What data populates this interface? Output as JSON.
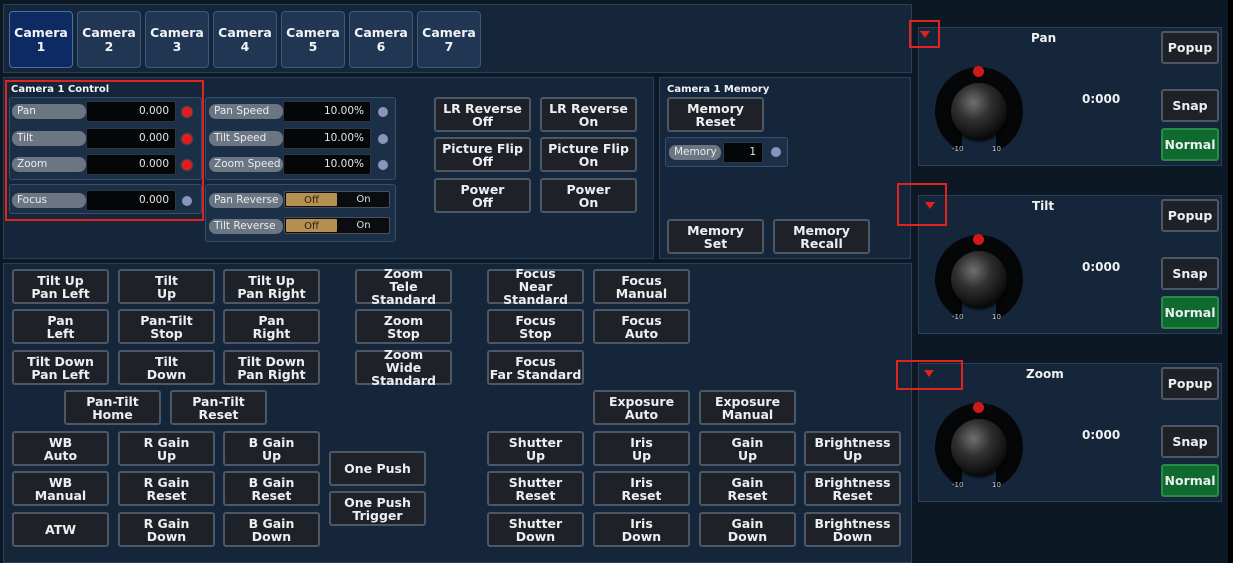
{
  "tabs": [
    "Camera\n1",
    "Camera\n2",
    "Camera\n3",
    "Camera\n4",
    "Camera\n5",
    "Camera\n6",
    "Camera\n7"
  ],
  "control": {
    "title": "Camera 1 Control",
    "fields": [
      {
        "label": "Pan",
        "value": "0.000",
        "status": "red"
      },
      {
        "label": "Tilt",
        "value": "0.000",
        "status": "red"
      },
      {
        "label": "Zoom",
        "value": "0.000",
        "status": "red"
      },
      {
        "label": "Focus",
        "value": "0.000",
        "status": "gray"
      }
    ],
    "speeds": [
      {
        "label": "Pan Speed",
        "value": "10.00%"
      },
      {
        "label": "Tilt Speed",
        "value": "10.00%"
      },
      {
        "label": "Zoom Speed",
        "value": "10.00%"
      }
    ],
    "reverses": [
      {
        "label": "Pan Reverse",
        "off": "Off",
        "on": "On",
        "selected": "Off"
      },
      {
        "label": "Tilt Reverse",
        "off": "Off",
        "on": "On",
        "selected": "Off"
      }
    ],
    "buttons": [
      "LR Reverse\nOff",
      "LR Reverse\nOn",
      "Picture Flip\nOff",
      "Picture Flip\nOn",
      "Power\nOff",
      "Power\nOn"
    ]
  },
  "memory": {
    "title": "Camera 1 Memory",
    "reset": "Memory\nReset",
    "label": "Memory",
    "value": "1",
    "set": "Memory\nSet",
    "recall": "Memory\nRecall"
  },
  "ptz": [
    "Tilt Up\nPan Left",
    "Tilt\nUp",
    "Tilt Up\nPan Right",
    "Pan\nLeft",
    "Pan-Tilt\nStop",
    "Pan\nRight",
    "Tilt Down\nPan Left",
    "Tilt\nDown",
    "Tilt Down\nPan Right",
    "Pan-Tilt\nHome",
    "Pan-Tilt\nReset"
  ],
  "zoom": [
    "Zoom\nTele Standard",
    "Zoom\nStop",
    "Zoom\nWide Standard"
  ],
  "focus": [
    "Focus\nNear Standard",
    "Focus\nManual",
    "Focus\nStop",
    "Focus\nAuto",
    "Focus\nFar Standard"
  ],
  "exposure": [
    "Exposure\nAuto",
    "Exposure\nManual"
  ],
  "wb": [
    "WB\nAuto",
    "R Gain\nUp",
    "B Gain\nUp",
    "WB\nManual",
    "R Gain\nReset",
    "B Gain\nReset",
    "ATW",
    "R Gain\nDown",
    "B Gain\nDown"
  ],
  "onepush": [
    "One Push",
    "One Push\nTrigger"
  ],
  "image": [
    "Shutter\nUp",
    "Iris\nUp",
    "Gain\nUp",
    "Brightness\nUp",
    "Shutter\nReset",
    "Iris\nReset",
    "Gain\nReset",
    "Brightness\nReset",
    "Shutter\nDown",
    "Iris\nDown",
    "Gain\nDown",
    "Brightness\nDown"
  ],
  "joysticks": [
    {
      "title": "Pan",
      "value": "0:000",
      "min": "-10",
      "max": "10",
      "popup": "Popup",
      "snap": "Snap",
      "normal": "Normal"
    },
    {
      "title": "Tilt",
      "value": "0:000",
      "min": "-10",
      "max": "10",
      "popup": "Popup",
      "snap": "Snap",
      "normal": "Normal"
    },
    {
      "title": "Zoom",
      "value": "0:000",
      "min": "-10",
      "max": "10",
      "popup": "Popup",
      "snap": "Snap",
      "normal": "Normal"
    }
  ],
  "colors": {
    "accent_red": "#e0231f",
    "active_tab": "#0d2a62",
    "normal_green": "#0e6a2e",
    "toggle_selected": "#b69052"
  }
}
